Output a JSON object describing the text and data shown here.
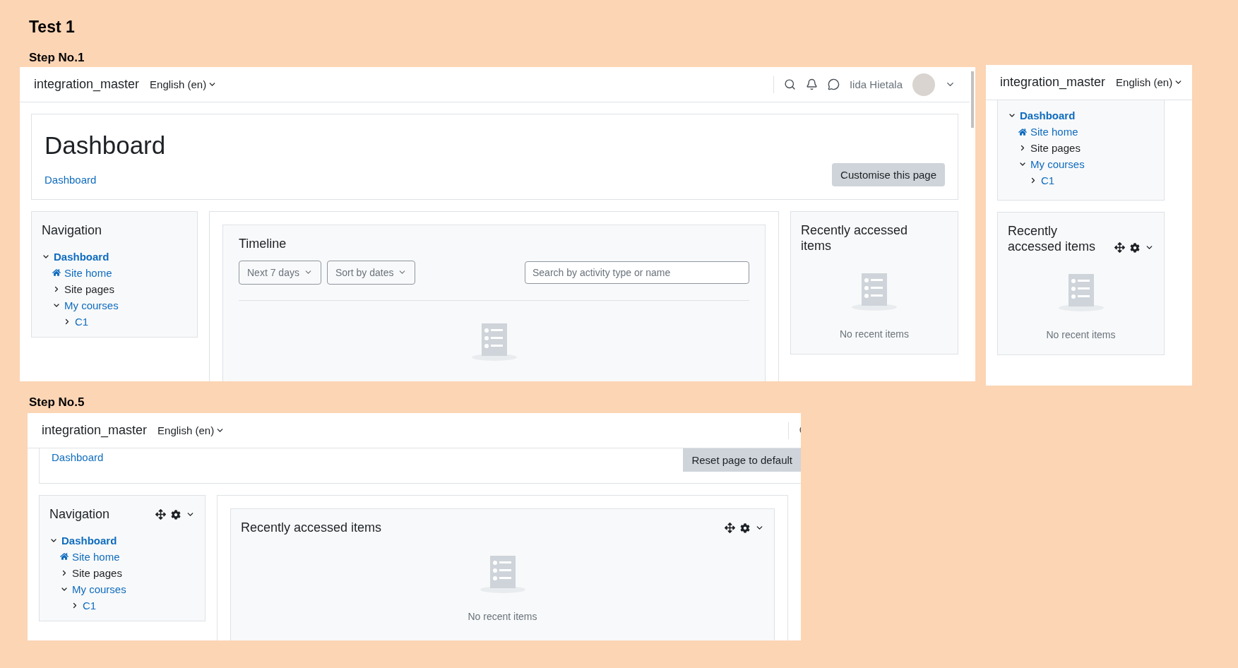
{
  "title": "Test 1",
  "steps": [
    {
      "label": "Step No.1",
      "screens": [
        {
          "kind": "dashboard",
          "navbar": {
            "site_name": "integration_master",
            "language": "English (en)",
            "user_name": "Iida Hietala"
          },
          "header": {
            "title": "Dashboard",
            "breadcrumb": "Dashboard",
            "button": "Customise this page"
          },
          "navigation": {
            "title": "Navigation",
            "controls": false,
            "tree": [
              {
                "label": "Dashboard",
                "kind": "branch",
                "expanded": true,
                "link": true,
                "children": [
                  {
                    "label": "Site home",
                    "kind": "home",
                    "link": true
                  },
                  {
                    "label": "Site pages",
                    "kind": "branch",
                    "expanded": false,
                    "link": false
                  },
                  {
                    "label": "My courses",
                    "kind": "branch",
                    "expanded": true,
                    "link": true,
                    "children": [
                      {
                        "label": "C1",
                        "kind": "branch",
                        "expanded": false,
                        "link": true
                      }
                    ]
                  }
                ]
              }
            ]
          },
          "timeline": {
            "title": "Timeline",
            "filters": [
              "Next 7 days",
              "Sort by dates"
            ],
            "search": {
              "placeholder": "Search by activity type or name"
            }
          },
          "recent": {
            "title": "Recently accessed items",
            "empty_text": "No recent items",
            "controls": false
          }
        },
        {
          "kind": "sidebar",
          "navbar": {
            "site_name": "integration_master",
            "language": "English (en)"
          },
          "navigation": {
            "tree": [
              {
                "label": "Dashboard",
                "kind": "branch",
                "expanded": true,
                "link": true,
                "children": [
                  {
                    "label": "Site home",
                    "kind": "home",
                    "link": true
                  },
                  {
                    "label": "Site pages",
                    "kind": "branch",
                    "expanded": false,
                    "link": false
                  },
                  {
                    "label": "My courses",
                    "kind": "branch",
                    "expanded": true,
                    "link": true,
                    "children": [
                      {
                        "label": "C1",
                        "kind": "branch",
                        "expanded": false,
                        "link": true
                      }
                    ]
                  }
                ]
              }
            ]
          },
          "recent": {
            "title": "Recently accessed items",
            "empty_text": "No recent items",
            "controls": true
          }
        }
      ]
    },
    {
      "label": "Step No.5",
      "screens": [
        {
          "kind": "editing",
          "navbar": {
            "site_name": "integration_master",
            "language": "English (en)"
          },
          "header": {
            "breadcrumb": "Dashboard",
            "button": "Reset page to default"
          },
          "navigation": {
            "title": "Navigation",
            "controls": true,
            "tree": [
              {
                "label": "Dashboard",
                "kind": "branch",
                "expanded": true,
                "link": true,
                "children": [
                  {
                    "label": "Site home",
                    "kind": "home",
                    "link": true
                  },
                  {
                    "label": "Site pages",
                    "kind": "branch",
                    "expanded": false,
                    "link": false
                  },
                  {
                    "label": "My courses",
                    "kind": "branch",
                    "expanded": true,
                    "link": true,
                    "children": [
                      {
                        "label": "C1",
                        "kind": "branch",
                        "expanded": false,
                        "link": true
                      }
                    ]
                  }
                ]
              }
            ]
          },
          "recent": {
            "title": "Recently accessed items",
            "empty_text": "No recent items",
            "controls": true
          }
        }
      ]
    }
  ]
}
